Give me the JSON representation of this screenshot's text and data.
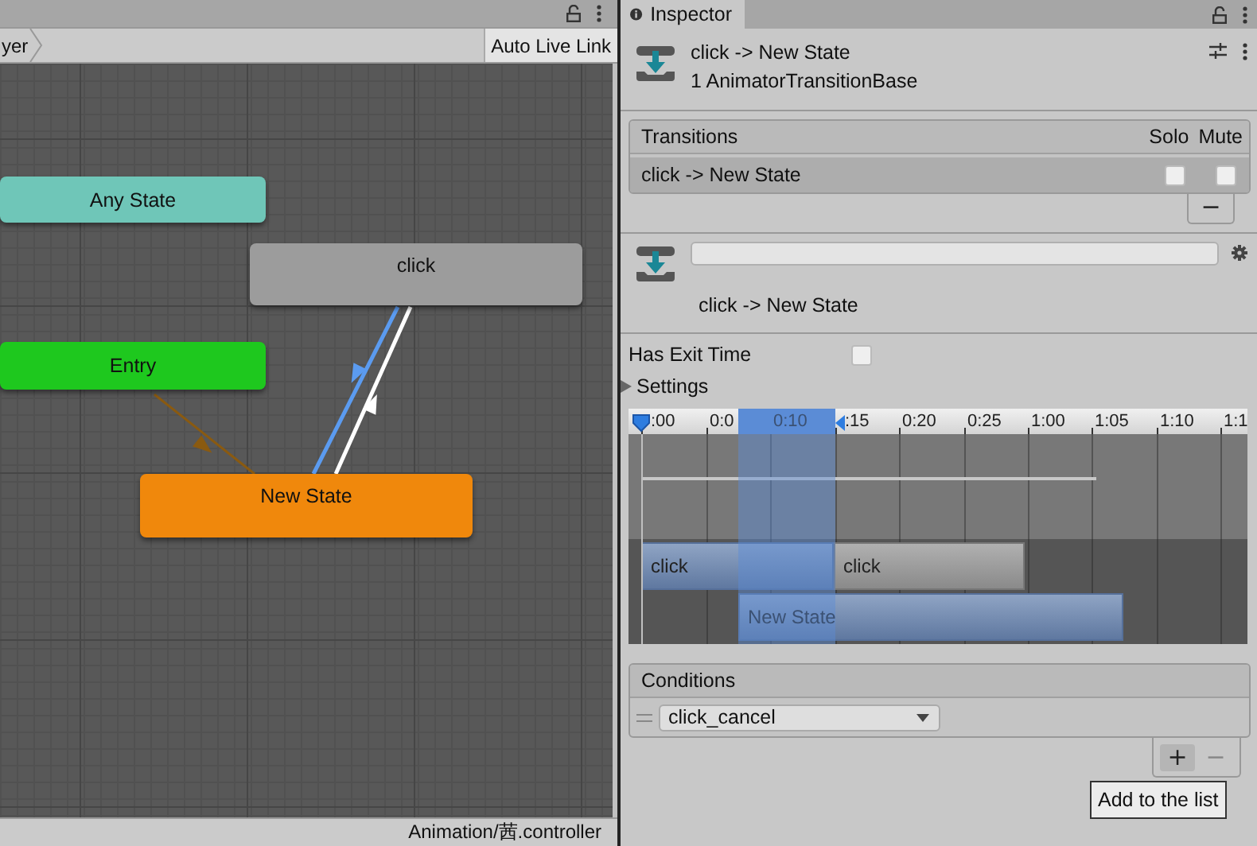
{
  "graph": {
    "breadcrumb": "yer",
    "auto_live_link": "Auto Live Link",
    "nodes": [
      {
        "kind": "any",
        "label": "Any State",
        "color": "#6fc6b8"
      },
      {
        "kind": "state",
        "label": "click",
        "color": "#9c9c9c"
      },
      {
        "kind": "entry",
        "label": "Entry",
        "color": "#1ec81e"
      },
      {
        "kind": "default",
        "label": "New State",
        "color": "#f0880c"
      }
    ],
    "transitions": [
      {
        "kind": "state",
        "selected": true
      },
      {
        "kind": "state",
        "selected": false
      },
      {
        "kind": "entry",
        "selected": false
      }
    ],
    "status_path": "Animation/茜.controller"
  },
  "inspector": {
    "tab": "Inspector",
    "title": "click -> New State",
    "subtitle": "1 AnimatorTransitionBase",
    "transitions": {
      "header": "Transitions",
      "solo_header": "Solo",
      "mute_header": "Mute",
      "remove": "−",
      "rows": [
        {
          "name": "click -> New State",
          "selected": true,
          "solo": false,
          "mute": false
        }
      ]
    },
    "transition_label": "click -> New State",
    "has_exit_time": {
      "label": "Has Exit Time",
      "checked": false
    },
    "settings": {
      "label": "Settings",
      "expanded": false
    },
    "timeline": {
      "ticks": [
        ":00",
        "0:0",
        "0:10",
        ":15",
        "0:20",
        "0:25",
        "1:00",
        "1:05",
        "1:10",
        "1:1"
      ],
      "clips": [
        {
          "label": "click",
          "selected": true
        },
        {
          "label": "click",
          "selected": false
        },
        {
          "label": "New State",
          "selected": true
        }
      ]
    },
    "conditions": {
      "header": "Conditions",
      "add": "+",
      "remove": "−",
      "items": [
        {
          "parameter": "click_cancel"
        }
      ]
    },
    "tooltip": "Add to the list"
  }
}
